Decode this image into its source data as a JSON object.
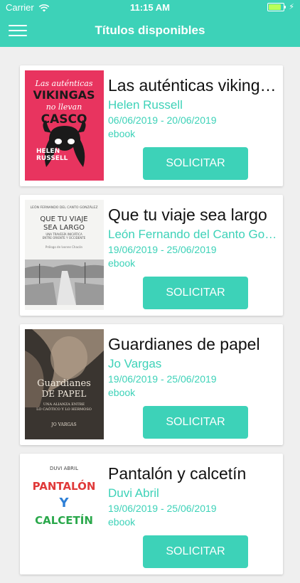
{
  "status": {
    "carrier": "Carrier",
    "time": "11:15 AM",
    "bolt": "⚡"
  },
  "header": {
    "title": "Títulos disponibles"
  },
  "books": [
    {
      "title": "Las auténticas vikingas no llevan casco",
      "author": "Helen Russell",
      "dates": "06/06/2019 - 20/06/2019",
      "format": "ebook",
      "action": "SOLICITAR",
      "cover": {
        "line1": "Las auténticas",
        "line2": "VIKINGAS",
        "line3": "no llevan",
        "line4": "CASCO",
        "author1": "HELEN",
        "author2": "RUSSELL"
      }
    },
    {
      "title": "Que tu viaje sea largo",
      "author": "León Fernando del Canto González",
      "dates": "19/06/2019 - 25/06/2019",
      "format": "ebook",
      "action": "SOLICITAR",
      "cover": {
        "top": "LEÓN FERNANDO DEL CANTO GONZÁLEZ",
        "line1": "QUE TU VIAJE",
        "line2": "SEA LARGO",
        "sub1": "UNA TRAVESÍA INICIÁTICA",
        "sub2": "ENTRE ORIENTE Y OCCIDENTE",
        "prologue": "Prólogo de Ivonne Chacón"
      }
    },
    {
      "title": "Guardianes de papel",
      "author": "Jo Vargas",
      "dates": "19/06/2019 - 25/06/2019",
      "format": "ebook",
      "action": "SOLICITAR",
      "cover": {
        "line1": "Guardianes",
        "line2": "DE PAPEL",
        "sub1": "UNA ALIANZA ENTRE",
        "sub2": "LO CAÓTICO Y LO HERMOSO",
        "author": "JO VARGAS"
      }
    },
    {
      "title": "Pantalón y calcetín",
      "author": "Duvi Abril",
      "dates": "19/06/2019 - 25/06/2019",
      "format": "ebook",
      "action": "SOLICITAR",
      "cover": {
        "author": "DUVI ABRIL",
        "line1": "PANTALÓN",
        "line2": "Y",
        "line3": "CALCETÍN"
      }
    }
  ],
  "colors": {
    "accent": "#3dd2b8",
    "background": "#efefef"
  }
}
